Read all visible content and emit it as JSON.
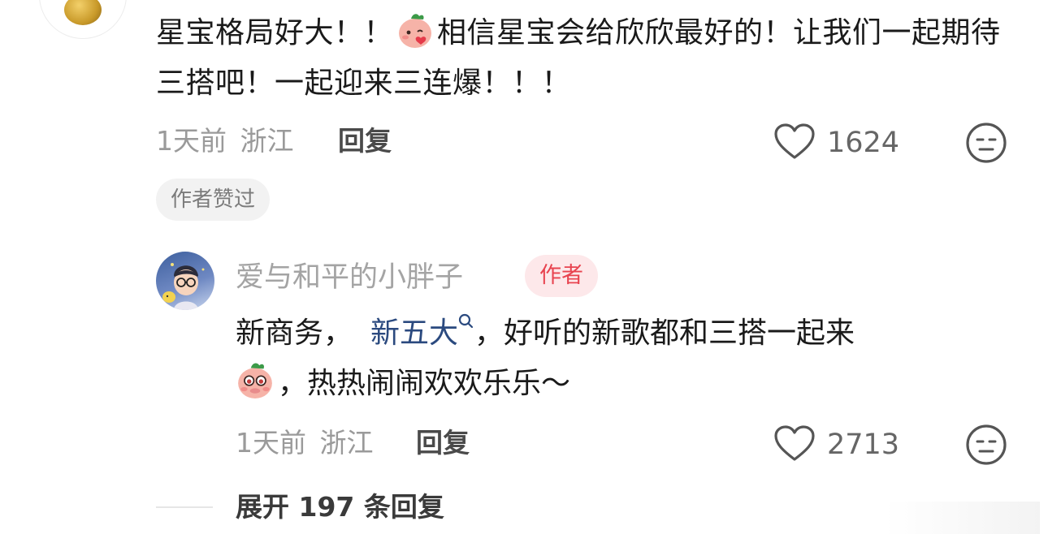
{
  "comment1": {
    "text_part1": "星宝格局好大！！",
    "text_part2": "相信星宝会给欣欣最好的！让我们一起期待三搭吧！一起迎来三连爆！！！",
    "emoji": "blush-kiss-emoji",
    "time": "1天前",
    "location": "浙江",
    "reply_label": "回复",
    "like_count": "1624",
    "author_liked_badge": "作者赞过"
  },
  "reply1": {
    "username": "爱与和平的小胖子",
    "author_tag": "作者",
    "text_prefix": "新商务，",
    "topic_link": "新五大",
    "text_middle": "，好听的新歌都和三搭一起来",
    "emoji": "peeking-emoji",
    "text_suffix": "，热热闹闹欢欢乐乐～",
    "time": "1天前",
    "location": "浙江",
    "reply_label": "回复",
    "like_count": "2713"
  },
  "expand_replies": "展开 197 条回复",
  "colors": {
    "author_tag_bg": "#fde8ea",
    "author_tag_text": "#e8434f",
    "topic_link": "#2b4a7f"
  }
}
